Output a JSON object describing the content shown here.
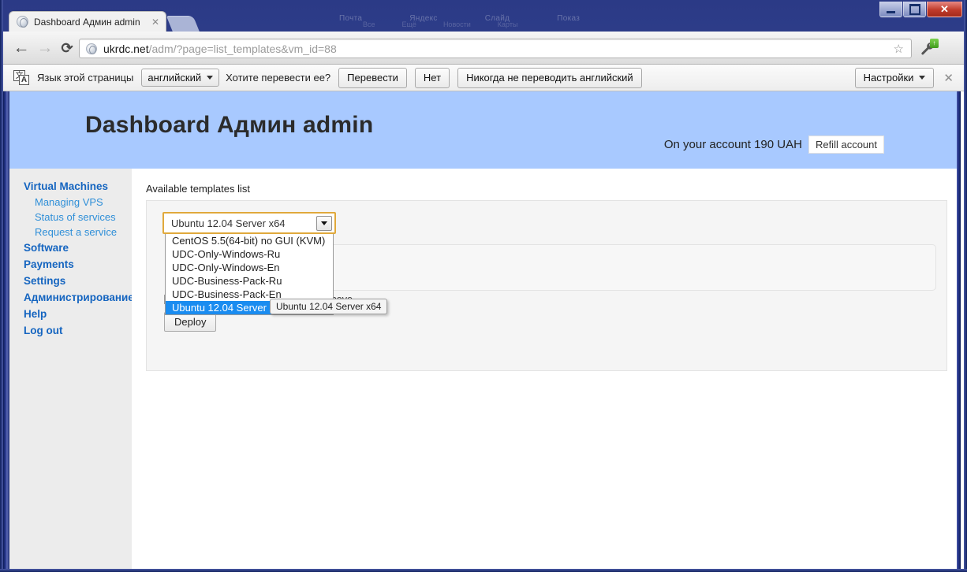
{
  "window": {
    "controls": {
      "minimize": "–",
      "maximize": "□",
      "close": "✕"
    },
    "ghost_labels_row1": [
      "Почта",
      "Яндекс",
      "Слайд",
      "Показ"
    ],
    "ghost_labels_row2": [
      "Все",
      "Ещё",
      "Новости",
      "Карты"
    ]
  },
  "browser": {
    "tab": {
      "title": "Dashboard Админ admin",
      "close_label": "✕",
      "favicon": "globe-icon"
    },
    "nav": {
      "back": "←",
      "forward": "→",
      "reload": "⟳"
    },
    "omnibox": {
      "domain": "ukrdc.net",
      "path": "/adm/?page=list_templates&vm_id=88",
      "full_url": "ukrdc.net/adm/?page=list_templates&vm_id=88",
      "star": "☆",
      "favicon": "globe-icon"
    },
    "menu": {
      "wrench": "🔧",
      "update_badge": "↑"
    }
  },
  "translate_bar": {
    "icon_cjk": "文",
    "icon_latin": "A",
    "label": "Язык этой страницы",
    "language_select": {
      "value": "английский",
      "caret": "▾"
    },
    "question": "Хотите перевести ее?",
    "translate_button": "Перевести",
    "no_button": "Нет",
    "never_button": "Никогда не переводить английский",
    "settings_button": {
      "label": "Настройки",
      "caret": "▾"
    },
    "close": "✕"
  },
  "page": {
    "title": "Dashboard Админ admin",
    "account": {
      "text": "On your account 190 UAH",
      "refill_button": "Refill account"
    },
    "header_color": "#a8c9ff",
    "accent_color": "#1565c0"
  },
  "sidebar": {
    "items": [
      {
        "label": "Virtual Machines",
        "level": "top"
      },
      {
        "label": "Managing VPS",
        "level": "sub"
      },
      {
        "label": "Status of services",
        "level": "sub"
      },
      {
        "label": "Request a service",
        "level": "sub"
      },
      {
        "label": "Software",
        "level": "top"
      },
      {
        "label": "Payments",
        "level": "top"
      },
      {
        "label": "Settings",
        "level": "top"
      },
      {
        "label": "Администрирование",
        "level": "top"
      },
      {
        "label": "Help",
        "level": "top"
      },
      {
        "label": "Log out",
        "level": "top"
      }
    ]
  },
  "main": {
    "section_label": "Available templates list",
    "template_select": {
      "value": "Ubuntu 12.04 Server x64",
      "arrow": "▾",
      "expanded": true,
      "options": [
        "CentOS 5.5(64-bit) no GUI (KVM)",
        "UDC-Only-Windows-Ru",
        "UDC-Only-Windows-En",
        "UDC-Business-Pack-Ru",
        "UDC-Business-Pack-En",
        "Ubuntu 12.04 Server x64"
      ],
      "selected_index": 5
    },
    "tooltip": "Ubuntu 12.04 Server x64",
    "agree_text": "I agree with terms and conditions above",
    "deploy_button": "Deploy"
  }
}
